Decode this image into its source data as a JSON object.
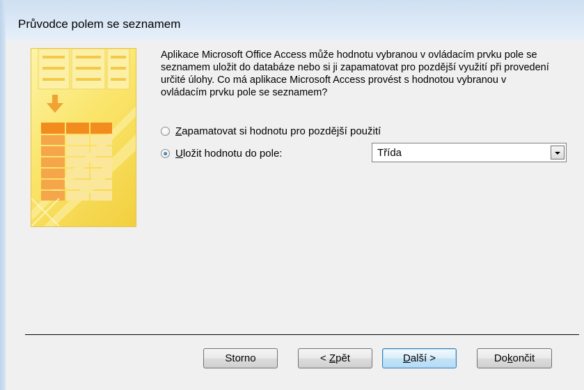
{
  "window": {
    "title": "Průvodce polem se seznamem"
  },
  "description": "Aplikace Microsoft Office Access může hodnotu vybranou v ovládacím prvku pole se seznamem uložit do databáze nebo si ji zapamatovat pro pozdější využití při provedení určité úlohy. Co má aplikace Microsoft Access provést s hodnotou vybranou v ovládacím prvku pole se seznamem?",
  "options": {
    "remember": {
      "access_key": "Z",
      "label_rest": "apamatovat si hodnotu pro pozdější použití",
      "checked": false
    },
    "store": {
      "access_key": "U",
      "label_rest": "ložit hodnotu do pole:",
      "checked": true
    }
  },
  "field_select": {
    "value": "Třída"
  },
  "buttons": {
    "cancel": {
      "label": "Storno"
    },
    "back": {
      "pre": "< ",
      "access_key": "Z",
      "post": "pět"
    },
    "next": {
      "pre": "",
      "access_key": "D",
      "post": "alší >"
    },
    "finish": {
      "pre": "Do",
      "access_key": "k",
      "post": "ončit"
    }
  },
  "colors": {
    "illustration": "#fae56b",
    "default_button_border": "#3c7fb1"
  }
}
